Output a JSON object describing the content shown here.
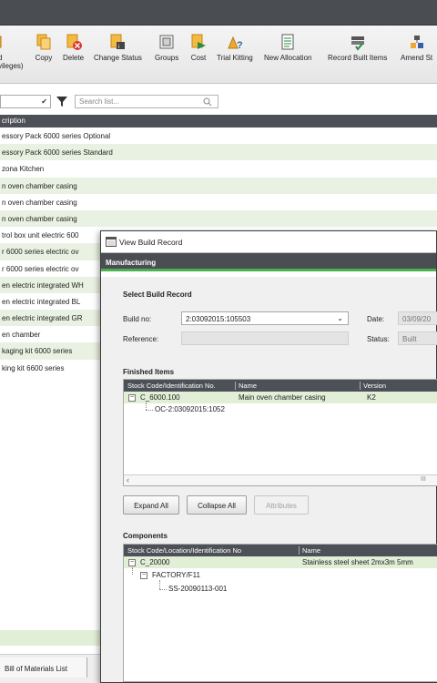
{
  "toolbar": {
    "partial_button": {
      "line1": "d",
      "line2": "vileges)"
    },
    "buttons": [
      {
        "label": "Copy"
      },
      {
        "label": "Delete"
      },
      {
        "label": "Change Status"
      },
      {
        "label": "Groups"
      },
      {
        "label": "Cost"
      },
      {
        "label": "Trial Kitting"
      },
      {
        "label": "New Allocation"
      },
      {
        "label": "Record Built Items"
      },
      {
        "label": "Amend St"
      }
    ]
  },
  "filter": {
    "search_placeholder": "Search list..."
  },
  "list": {
    "header": "cription",
    "rows": [
      "essory Pack 6000 series Optional",
      "essory Pack 6000 series Standard",
      "zona Kitchen",
      "n oven chamber casing",
      "n oven chamber casing",
      "n oven chamber casing",
      "trol box unit electric 600",
      "r 6000 series electric ov",
      "r 6000 series electric ov",
      "en electric integrated WH",
      "en electric integrated BL",
      "en electric integrated GR",
      "en chamber",
      "kaging kit 6000 series",
      "king kit 6600 series"
    ]
  },
  "bottom": {
    "tab_label": "Bill of Materials List"
  },
  "dialog": {
    "title": "View Build Record",
    "header": "Manufacturing",
    "select_section": {
      "title": "Select Build Record",
      "build_no_label": "Build no:",
      "build_no_value": "2:03092015:105503",
      "date_label": "Date:",
      "date_value": "03/09/20",
      "reference_label": "Reference:",
      "reference_value": "",
      "status_label": "Status:",
      "status_value": "Built"
    },
    "finished_items": {
      "title": "Finished Items",
      "columns": [
        "Stock Code/Identification No.",
        "Name",
        "Version"
      ],
      "rows": [
        {
          "code": "C_6000.100",
          "name": "Main oven chamber casing",
          "version": "K2"
        },
        {
          "code": "OC-2:03092015:1052",
          "name": "",
          "version": ""
        }
      ],
      "scroll_grip": "III"
    },
    "buttons": {
      "expand_all": "Expand All",
      "collapse_all": "Collapse All",
      "attributes": "Attributes"
    },
    "components": {
      "title": "Components",
      "columns": [
        "Stock Code/Location/Identification No",
        "Name"
      ],
      "rows": [
        {
          "code": "C_20000",
          "name": "Stainless steel sheet 2mx3m 5mm"
        },
        {
          "code": "FACTORY/F11",
          "name": ""
        },
        {
          "code": "SS-20090113-001",
          "name": ""
        }
      ]
    }
  },
  "colors": {
    "accent_green": "#4caf50",
    "header_dark": "#4d5157",
    "row_alt": "#e9f2e2"
  }
}
